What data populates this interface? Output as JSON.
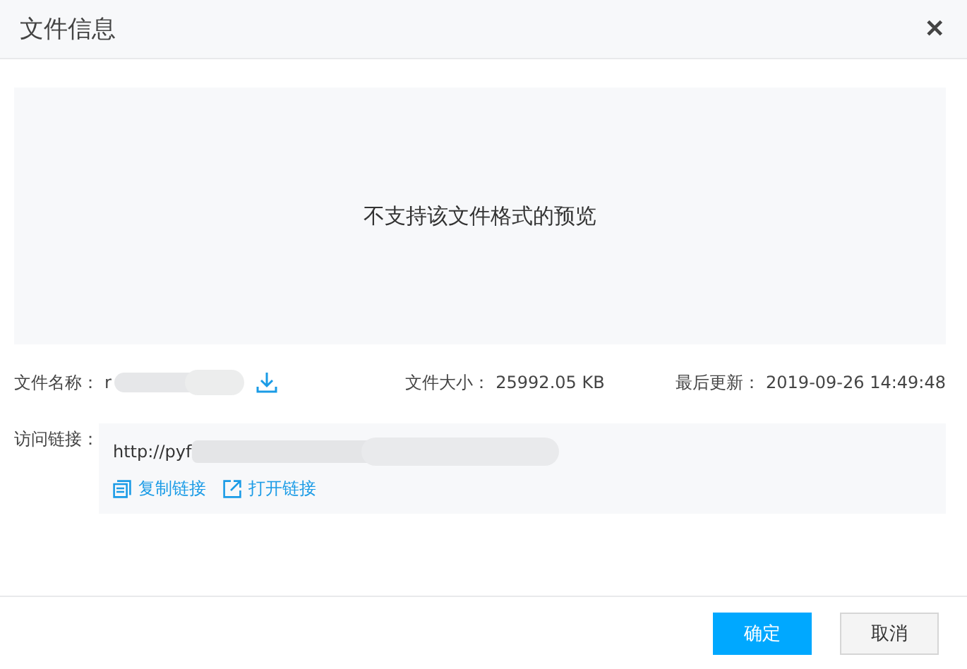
{
  "window": {
    "title": "文件信息",
    "close": "✕"
  },
  "preview": {
    "message": "不支持该文件格式的预览"
  },
  "info": [
    {
      "label": "文件名称：",
      "kind": "redacted",
      "value": "r"
    },
    {
      "label": "文件大小：",
      "kind": "text",
      "value": "25992.05 KB"
    },
    {
      "label": "最后更新：",
      "kind": "text",
      "value": "2019-09-26 14:49:48"
    }
  ],
  "link": {
    "label": "访问链接：",
    "url": "http://pyf",
    "actions": [
      {
        "label": "复制链接",
        "kind": "copy"
      },
      {
        "label": "打开链接",
        "kind": "open"
      }
    ]
  },
  "buttons": [
    {
      "label": "确定",
      "kind": "primary"
    },
    {
      "label": "取消",
      "kind": "default"
    }
  ]
}
